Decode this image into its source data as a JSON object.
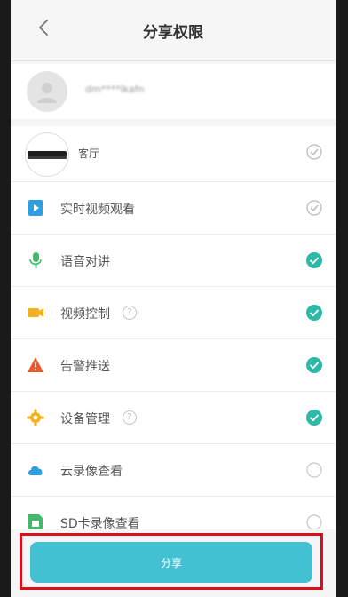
{
  "header": {
    "title": "分享权限",
    "back_icon": "chevron-left-icon"
  },
  "account": {
    "name": "dm****lkafn"
  },
  "device": {
    "label": "客厅",
    "checked": true,
    "check_style": "outline"
  },
  "permissions": [
    {
      "label": "实时视频观看",
      "icon": "video-file-icon",
      "icon_color": "#2e9fe0",
      "checked": true,
      "check_style": "outline",
      "help": false
    },
    {
      "label": "语音对讲",
      "icon": "microphone-icon",
      "icon_color": "#42b96b",
      "checked": true,
      "check_style": "filled",
      "help": false
    },
    {
      "label": "视频控制",
      "icon": "camera-icon",
      "icon_color": "#f3b21d",
      "checked": true,
      "check_style": "filled",
      "help": true,
      "help_symbol": "?"
    },
    {
      "label": "告警推送",
      "icon": "alarm-icon",
      "icon_color": "#ea5a2d",
      "checked": true,
      "check_style": "filled",
      "help": false
    },
    {
      "label": "设备管理",
      "icon": "gear-icon",
      "icon_color": "#f3b21d",
      "checked": true,
      "check_style": "filled",
      "help": true,
      "help_symbol": "?"
    },
    {
      "label": "云录像查看",
      "icon": "cloud-icon",
      "icon_color": "#2e9fe0",
      "checked": false,
      "check_style": "empty",
      "help": false
    },
    {
      "label": "SD卡录像查看",
      "icon": "sd-card-icon",
      "icon_color": "#42b96b",
      "checked": false,
      "check_style": "empty",
      "help": false
    }
  ],
  "footer": {
    "share_label": "分享"
  },
  "colors": {
    "accent": "#43c1d2",
    "check_active": "#2cb9a8",
    "highlight": "#d6101c"
  }
}
